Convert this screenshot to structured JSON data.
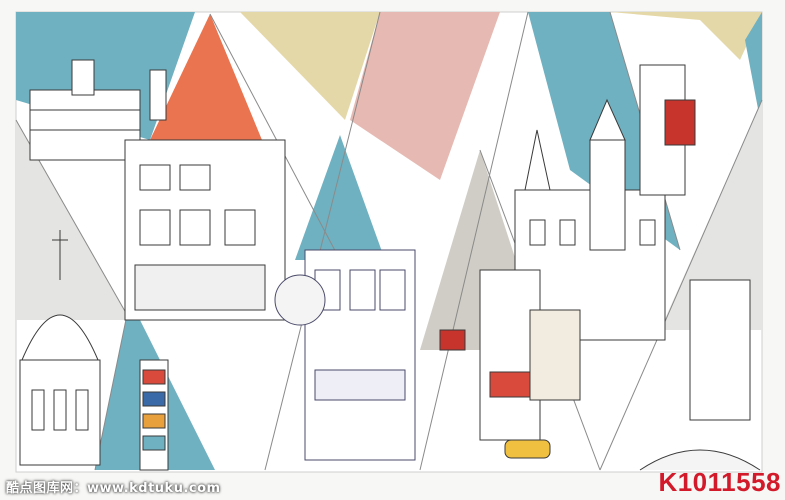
{
  "image": {
    "description_hidden": true
  },
  "watermark": {
    "site_text": "酷点图库网：www.kdtuku.com",
    "product_code": "K1011558"
  },
  "colors": {
    "teal": "#6fb1c1",
    "coral": "#e9744f",
    "blush": "#e6b9b3",
    "sand": "#e5d8a8",
    "gray": "#d0cdc6",
    "light_gray": "#e4e4e2",
    "paper": "#ffffff",
    "ink": "#3a3a3a",
    "code_red": "#d31a2a"
  }
}
